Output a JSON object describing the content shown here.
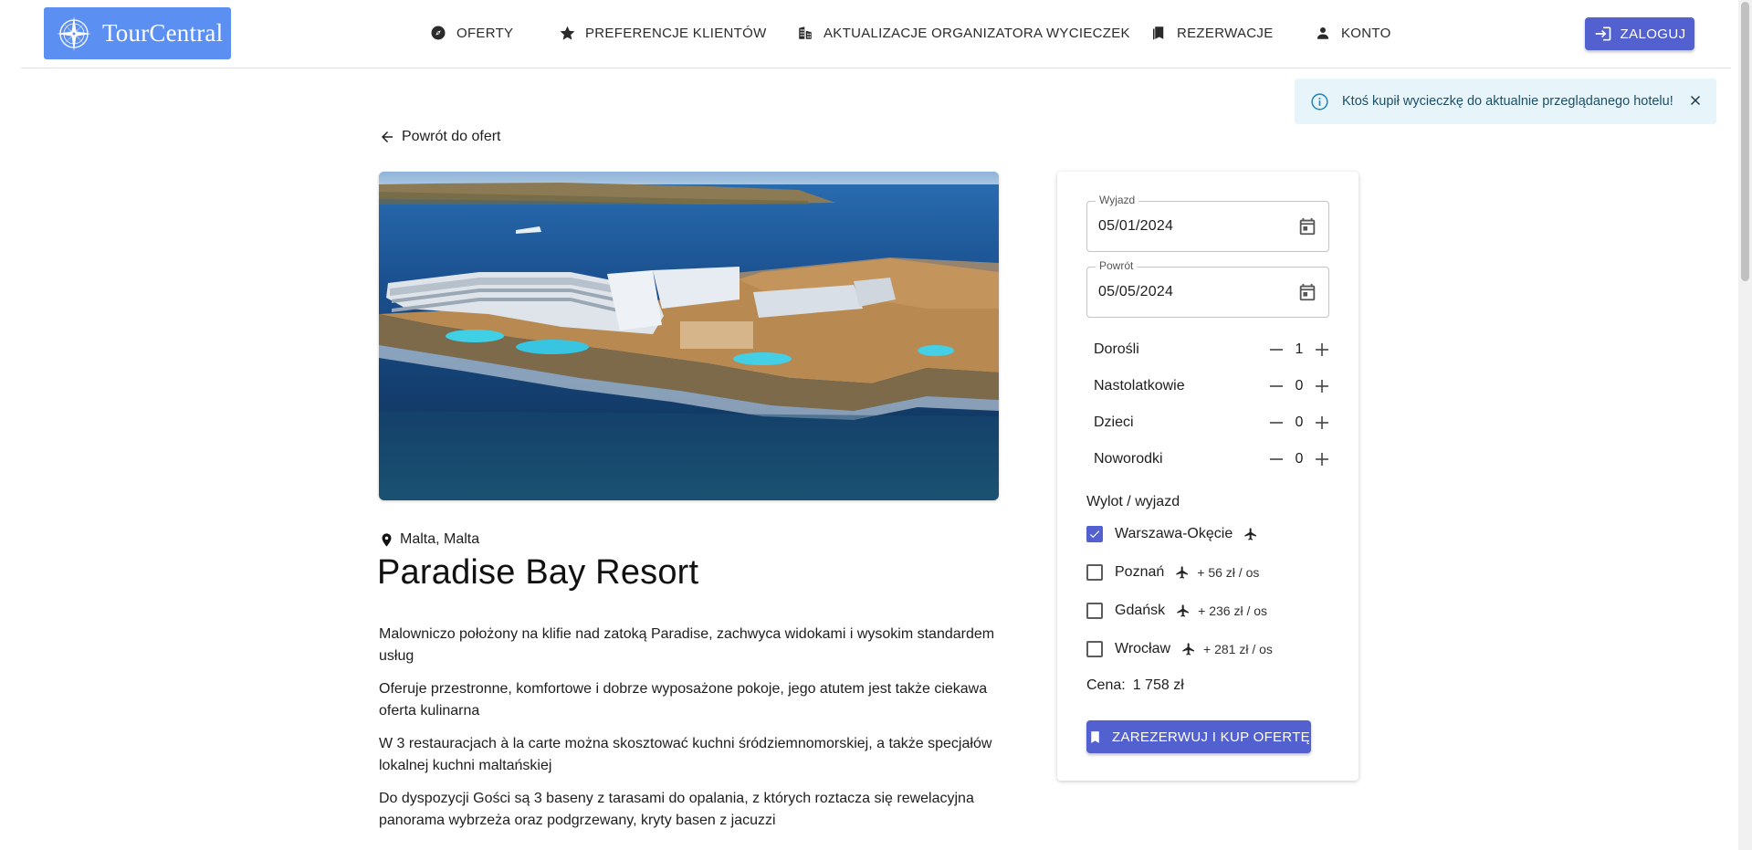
{
  "brand": {
    "name": "TourCentral"
  },
  "nav": {
    "items": [
      {
        "label": "OFERTY",
        "icon": "compass-icon"
      },
      {
        "label": "PREFERENCJE KLIENTÓW",
        "icon": "star-icon"
      },
      {
        "label": "AKTUALIZACJE ORGANIZATORA WYCIECZEK",
        "icon": "building-icon"
      },
      {
        "label": "REZERWACJE",
        "icon": "bookmarks-icon"
      },
      {
        "label": "KONTO",
        "icon": "person-icon"
      }
    ],
    "login_label": "ZALOGUJ"
  },
  "toast": {
    "message": "Ktoś kupił wycieczkę do aktualnie przeglądanego hotelu!"
  },
  "back": {
    "label": "Powrót do ofert"
  },
  "hotel": {
    "location": "Malta, Malta",
    "name": "Paradise Bay Resort",
    "description": [
      "Malowniczo położony na klifie nad zatoką Paradise, zachwyca widokami i wysokim standardem usług",
      "Oferuje przestronne, komfortowe i dobrze wyposażone pokoje, jego atutem jest także ciekawa oferta kulinarna",
      "W 3 restauracjach à la carte można skosztować kuchni śródziemnomorskiej, a także specjałów lokalnej kuchni maltańskiej",
      "Do dyspozycji Gości są 3 baseny z tarasami do opalania, z których roztacza się rewelacyjna panorama wybrzeża oraz podgrzewany, kryty basen z jacuzzi"
    ]
  },
  "booking": {
    "departure": {
      "label": "Wyjazd",
      "value": "05/01/2024"
    },
    "return": {
      "label": "Powrót",
      "value": "05/05/2024"
    },
    "passengers": [
      {
        "label": "Dorośli",
        "count": "1"
      },
      {
        "label": "Nastolatkowie",
        "count": "0"
      },
      {
        "label": "Dzieci",
        "count": "0"
      },
      {
        "label": "Noworodki",
        "count": "0"
      }
    ],
    "airports_label": "Wylot / wyjazd",
    "airports": [
      {
        "name": "Warszawa-Okęcie",
        "surcharge": "",
        "checked": true
      },
      {
        "name": "Poznań",
        "surcharge": "+ 56 zł / os",
        "checked": false
      },
      {
        "name": "Gdańsk",
        "surcharge": "+ 236 zł / os",
        "checked": false
      },
      {
        "name": "Wrocław",
        "surcharge": "+ 281 zł / os",
        "checked": false
      }
    ],
    "price_label": "Cena:",
    "price_value": "1 758 zł",
    "reserve_label": "ZAREZERWUJ I KUP OFERTĘ"
  },
  "colors": {
    "primary": "#5261cf",
    "logo_bg": "#5b8ff2",
    "toast_bg": "#e7f5fb"
  }
}
